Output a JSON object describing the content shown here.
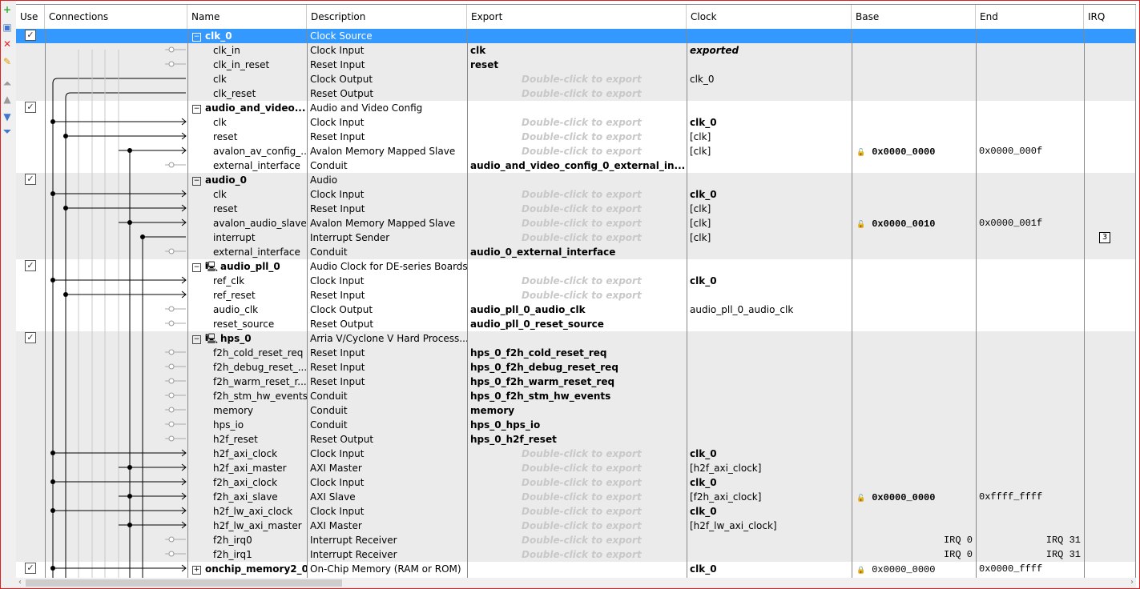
{
  "toolbar": {
    "icons": [
      "add-icon",
      "add-component-icon",
      "remove-icon",
      "edit-icon",
      "move-top-icon",
      "move-up-icon",
      "move-down-icon",
      "move-bottom-icon"
    ]
  },
  "columns": [
    "Use",
    "Connections",
    "Name",
    "Description",
    "Export",
    "Clock",
    "Base",
    "End",
    "IRQ"
  ],
  "colors": {
    "selection": "#3399ff",
    "group_gray": "#ebebeb",
    "placeholder": "#c8c8c8"
  },
  "rows": [
    {
      "group": true,
      "checked": true,
      "selected": true,
      "expander": "−",
      "name": "clk_0",
      "desc": "Clock Source",
      "export": "",
      "clock": ""
    },
    {
      "name": "clk_in",
      "desc": "Clock Input",
      "export": "clk",
      "export_style": "bold",
      "clock": "exported",
      "clock_style": "ital",
      "conn": "in-open"
    },
    {
      "name": "clk_in_reset",
      "desc": "Reset Input",
      "export": "reset",
      "export_style": "bold",
      "clock": "",
      "conn": "in-open"
    },
    {
      "name": "clk",
      "desc": "Clock Output",
      "export": "Double-click to export",
      "export_style": "ph",
      "clock": "clk_0",
      "conn": "out-clk"
    },
    {
      "name": "clk_reset",
      "desc": "Reset Output",
      "export": "Double-click to export",
      "export_style": "ph",
      "clock": "",
      "conn": "out-rst"
    },
    {
      "group": true,
      "checked": true,
      "expander": "−",
      "name": "audio_and_video...",
      "desc": "Audio and Video Config",
      "export": "",
      "clock": ""
    },
    {
      "name": "clk",
      "desc": "Clock Input",
      "export": "Double-click to export",
      "export_style": "ph",
      "clock": "clk_0",
      "clock_style": "bold",
      "conn": "clk"
    },
    {
      "name": "reset",
      "desc": "Reset Input",
      "export": "Double-click to export",
      "export_style": "ph",
      "clock": "[clk]",
      "conn": "rst"
    },
    {
      "name": "avalon_av_config_...",
      "desc": "Avalon Memory Mapped Slave",
      "export": "Double-click to export",
      "export_style": "ph",
      "clock": "[clk]",
      "base": "0x0000_0000",
      "end": "0x0000_000f",
      "conn": "slave"
    },
    {
      "name": "external_interface",
      "desc": "Conduit",
      "export": "audio_and_video_config_0_external_in...",
      "export_style": "bold",
      "clock": "",
      "conn": "conduit"
    },
    {
      "group": true,
      "checked": true,
      "expander": "−",
      "name": "audio_0",
      "desc": "Audio",
      "export": "",
      "clock": ""
    },
    {
      "name": "clk",
      "desc": "Clock Input",
      "export": "Double-click to export",
      "export_style": "ph",
      "clock": "clk_0",
      "clock_style": "bold",
      "conn": "clk"
    },
    {
      "name": "reset",
      "desc": "Reset Input",
      "export": "Double-click to export",
      "export_style": "ph",
      "clock": "[clk]",
      "conn": "rst"
    },
    {
      "name": "avalon_audio_slave",
      "desc": "Avalon Memory Mapped Slave",
      "export": "Double-click to export",
      "export_style": "ph",
      "clock": "[clk]",
      "base": "0x0000_0010",
      "end": "0x0000_001f",
      "conn": "slave"
    },
    {
      "name": "interrupt",
      "desc": "Interrupt Sender",
      "export": "Double-click to export",
      "export_style": "ph",
      "clock": "[clk]",
      "irq": "3",
      "conn": "irq"
    },
    {
      "name": "external_interface",
      "desc": "Conduit",
      "export": "audio_0_external_interface",
      "export_style": "bold",
      "clock": "",
      "conn": "conduit"
    },
    {
      "group": true,
      "checked": true,
      "expander": "−",
      "module_icon": true,
      "name": "audio_pll_0",
      "desc": "Audio Clock for DE-series Boards",
      "export": "",
      "clock": ""
    },
    {
      "name": "ref_clk",
      "desc": "Clock Input",
      "export": "Double-click to export",
      "export_style": "ph",
      "clock": "clk_0",
      "clock_style": "bold",
      "conn": "clk"
    },
    {
      "name": "ref_reset",
      "desc": "Reset Input",
      "export": "Double-click to export",
      "export_style": "ph",
      "clock": "",
      "conn": "rst"
    },
    {
      "name": "audio_clk",
      "desc": "Clock Output",
      "export": "audio_pll_0_audio_clk",
      "export_style": "bold",
      "clock": "audio_pll_0_audio_clk",
      "conn": "out-open"
    },
    {
      "name": "reset_source",
      "desc": "Reset Output",
      "export": "audio_pll_0_reset_source",
      "export_style": "bold",
      "clock": "",
      "conn": "out-open"
    },
    {
      "group": true,
      "checked": true,
      "expander": "−",
      "module_icon": true,
      "name": "hps_0",
      "desc": "Arria V/Cyclone V Hard Process...",
      "export": "",
      "clock": ""
    },
    {
      "name": "f2h_cold_reset_req",
      "desc": "Reset Input",
      "export": "hps_0_f2h_cold_reset_req",
      "export_style": "bold",
      "clock": "",
      "conn": "in-open"
    },
    {
      "name": "f2h_debug_reset_...",
      "desc": "Reset Input",
      "export": "hps_0_f2h_debug_reset_req",
      "export_style": "bold",
      "clock": "",
      "conn": "in-open"
    },
    {
      "name": "f2h_warm_reset_r...",
      "desc": "Reset Input",
      "export": "hps_0_f2h_warm_reset_req",
      "export_style": "bold",
      "clock": "",
      "conn": "in-open"
    },
    {
      "name": "f2h_stm_hw_events",
      "desc": "Conduit",
      "export": "hps_0_f2h_stm_hw_events",
      "export_style": "bold",
      "clock": "",
      "conn": "conduit"
    },
    {
      "name": "memory",
      "desc": "Conduit",
      "export": "memory",
      "export_style": "bold",
      "clock": "",
      "conn": "conduit"
    },
    {
      "name": "hps_io",
      "desc": "Conduit",
      "export": "hps_0_hps_io",
      "export_style": "bold",
      "clock": "",
      "conn": "conduit"
    },
    {
      "name": "h2f_reset",
      "desc": "Reset Output",
      "export": "hps_0_h2f_reset",
      "export_style": "bold",
      "clock": "",
      "conn": "out-open"
    },
    {
      "name": "h2f_axi_clock",
      "desc": "Clock Input",
      "export": "Double-click to export",
      "export_style": "ph",
      "clock": "clk_0",
      "clock_style": "bold",
      "conn": "clk"
    },
    {
      "name": "h2f_axi_master",
      "desc": "AXI Master",
      "export": "Double-click to export",
      "export_style": "ph",
      "clock": "[h2f_axi_clock]",
      "conn": "master"
    },
    {
      "name": "f2h_axi_clock",
      "desc": "Clock Input",
      "export": "Double-click to export",
      "export_style": "ph",
      "clock": "clk_0",
      "clock_style": "bold",
      "conn": "clk"
    },
    {
      "name": "f2h_axi_slave",
      "desc": "AXI Slave",
      "export": "Double-click to export",
      "export_style": "ph",
      "clock": "[f2h_axi_clock]",
      "base": "0x0000_0000",
      "end": "0xffff_ffff",
      "conn": "slave"
    },
    {
      "name": "h2f_lw_axi_clock",
      "desc": "Clock Input",
      "export": "Double-click to export",
      "export_style": "ph",
      "clock": "clk_0",
      "clock_style": "bold",
      "conn": "clk"
    },
    {
      "name": "h2f_lw_axi_master",
      "desc": "AXI Master",
      "export": "Double-click to export",
      "export_style": "ph",
      "clock": "[h2f_lw_axi_clock]",
      "conn": "master"
    },
    {
      "name": "f2h_irq0",
      "desc": "Interrupt Receiver",
      "export": "Double-click to export",
      "export_style": "ph",
      "clock": "",
      "base_irq": "IRQ 0",
      "end_irq": "IRQ 31",
      "conn": "irqr"
    },
    {
      "name": "f2h_irq1",
      "desc": "Interrupt Receiver",
      "export": "Double-click to export",
      "export_style": "ph",
      "clock": "",
      "base_irq": "IRQ 0",
      "end_irq": "IRQ 31",
      "conn": "irqr"
    },
    {
      "group": true,
      "checked": true,
      "expander": "+",
      "name": "onchip_memory2_0",
      "desc": "On-Chip Memory (RAM or ROM)",
      "export": "",
      "clock": "clk_0",
      "clock_style": "bold",
      "base": "0x0000_0000",
      "end": "0x0000_ffff",
      "locked": true,
      "conn": "clk"
    }
  ]
}
